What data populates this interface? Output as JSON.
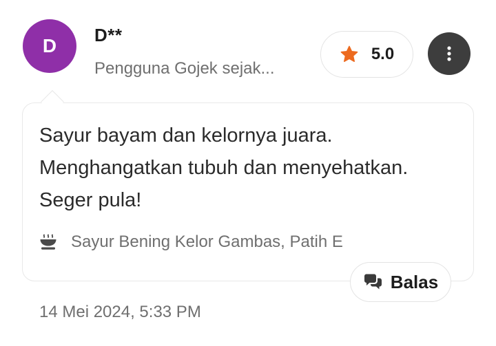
{
  "user": {
    "initial": "D",
    "name": "D**",
    "subtitle": "Pengguna Gojek sejak...",
    "avatar_color": "#8f2fa8"
  },
  "rating": {
    "value": "5.0",
    "icon": "star-icon",
    "star_color": "#ec6a1f"
  },
  "more_menu": {
    "icon": "more-vertical-icon",
    "background": "#3d3d3d"
  },
  "review": {
    "text": "Sayur bayam dan kelornya juara. Menghangatkan tubuh dan menyehatkan. Seger pula!",
    "dish_icon": "bowl-icon",
    "dish_name": "Sayur Bening Kelor Gambas, Patih E"
  },
  "reply_button": {
    "label": "Balas",
    "icon": "chat-bubbles-icon"
  },
  "timestamp": "14 Mei 2024, 5:33 PM"
}
